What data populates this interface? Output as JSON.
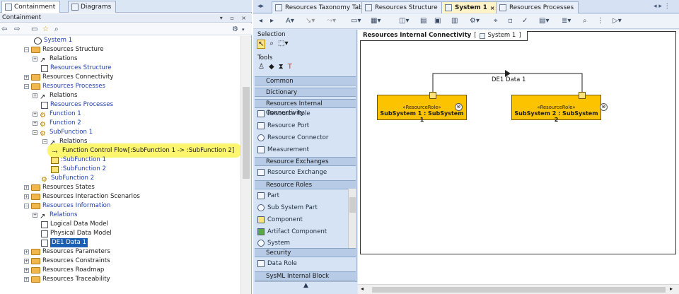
{
  "left_tabs": [
    {
      "label": "Containment",
      "active": true
    },
    {
      "label": "Diagrams",
      "active": false
    }
  ],
  "left_header": {
    "title": "Containment"
  },
  "tree": [
    {
      "label": "System 1",
      "link": true
    },
    {
      "label": "Resources Structure"
    },
    {
      "label": "Relations"
    },
    {
      "label": "Resources Structure",
      "link": true
    },
    {
      "label": "Resources Connectivity"
    },
    {
      "label": "Resources Processes"
    },
    {
      "label": "Relations"
    },
    {
      "label": "Resources Processes",
      "link": true
    },
    {
      "label": "Function 1",
      "link": true
    },
    {
      "label": "Function 2",
      "link": true
    },
    {
      "label": "SubFunction 1",
      "link": true
    },
    {
      "label": "Relations"
    },
    {
      "label": "Function Control Flow[:SubFunction 1 -> :SubFunction 2]"
    },
    {
      "label": ":SubFunction 1",
      "link": true
    },
    {
      "label": ":SubFunction 2",
      "link": true
    },
    {
      "label": "SubFunction 2",
      "link": true
    },
    {
      "label": "Resources States"
    },
    {
      "label": "Resources Interaction Scenarios"
    },
    {
      "label": "Resources Information",
      "link": true
    },
    {
      "label": "Relations",
      "link": true
    },
    {
      "label": "Logical Data Model"
    },
    {
      "label": "Physical Data Model"
    },
    {
      "label": "DE1 Data 1",
      "selected": true
    },
    {
      "label": "Resources Parameters"
    },
    {
      "label": "Resources Constraints"
    },
    {
      "label": "Resources Roadmap"
    },
    {
      "label": "Resources Traceability"
    }
  ],
  "editor_tabs": [
    {
      "label": "Resources Taxonomy Table",
      "active": false
    },
    {
      "label": "Resources Structure",
      "active": false
    },
    {
      "label": "System 1",
      "active": true,
      "close": "×"
    },
    {
      "label": "Resources Processes",
      "active": false
    }
  ],
  "palette": {
    "selection": "Selection",
    "tools": "Tools",
    "groups": [
      "Common",
      "Dictionary",
      "Resources Internal Connectivity",
      "Resource Exchanges",
      "Resource Roles",
      "Security",
      "SysML Internal Block Diagram"
    ],
    "connectivity_items": [
      "Resource Role",
      "Resource Port",
      "Resource Connector",
      "Measurement"
    ],
    "exchange_items": [
      "Resource Exchange"
    ],
    "role_items": [
      "Part",
      "Sub System Part",
      "Component",
      "Artifact Component",
      "System"
    ],
    "security_items": [
      "Data Role"
    ]
  },
  "diagram": {
    "title": "Resources Internal Connectivity",
    "context": "System 1",
    "parts": [
      {
        "stereotype": "«ResourceRole»",
        "name": "SubSystem 1 : SubSystem 1"
      },
      {
        "stereotype": "«ResourceRole»",
        "name": "SubSystem 2 : SubSystem 2"
      }
    ],
    "connector_label": "DE1 Data 1"
  },
  "colors": {
    "part_fill": "#fcc400",
    "selection_fill": "#1a5fb4",
    "highlight": "#fbf55e",
    "palette_bg": "#d5e3f5"
  }
}
